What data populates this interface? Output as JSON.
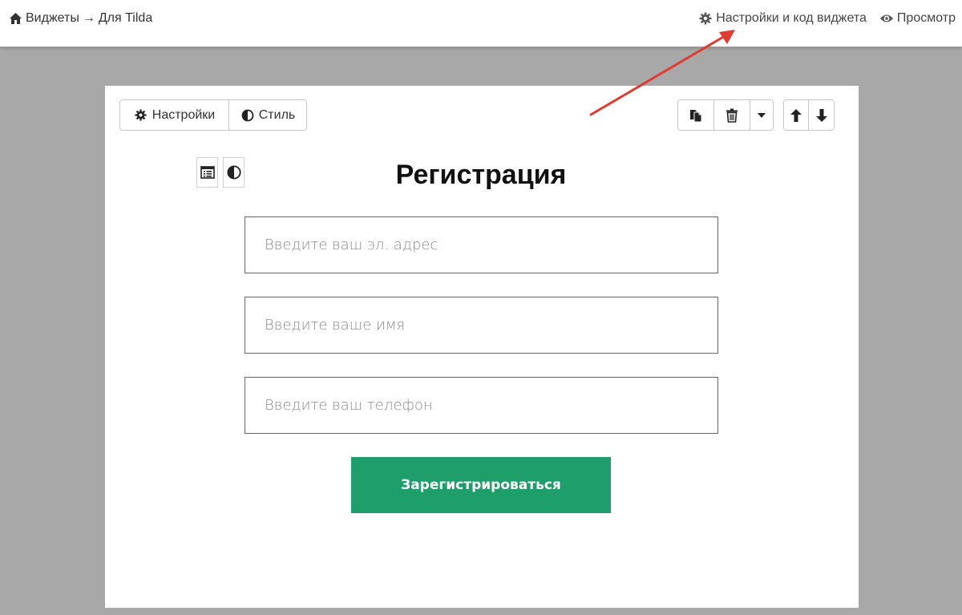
{
  "header": {
    "breadcrumb": {
      "home_icon": "home-icon",
      "root": "Виджеты",
      "separator": "→",
      "current": "Для Tilda"
    },
    "settings_link": {
      "icon": "gear-icon",
      "label": "Настройки и код виджета"
    },
    "preview_link": {
      "icon": "eye-icon",
      "label": "Просмотр"
    }
  },
  "toolbar": {
    "settings_label": "Настройки",
    "style_label": "Стиль",
    "copy_icon": "copy-icon",
    "delete_icon": "trash-icon",
    "dropdown_icon": "caret-down-icon",
    "up_icon": "arrow-up-icon",
    "down_icon": "arrow-down-icon"
  },
  "form": {
    "title": "Регистрация",
    "fields": [
      {
        "placeholder": "Введите ваш эл. адрес",
        "value": ""
      },
      {
        "placeholder": "Введите ваше имя",
        "value": ""
      },
      {
        "placeholder": "Введите ваш телефон",
        "value": ""
      }
    ],
    "submit_label": "Зарегистрироваться"
  },
  "colors": {
    "submit_bg": "#1d9e6a",
    "annotation_arrow": "#e03b2f",
    "page_bg": "#a8a8a8"
  }
}
